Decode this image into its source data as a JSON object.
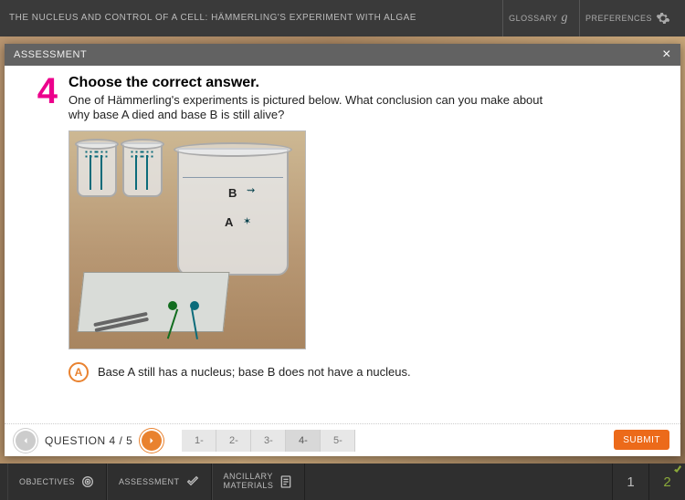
{
  "header": {
    "title": "THE NUCLEUS AND CONTROL OF A CELL: HÄMMERLING'S EXPERIMENT WITH ALGAE",
    "glossary_label": "GLOSSARY",
    "preferences_label": "PREFERENCES"
  },
  "panel": {
    "title": "ASSESSMENT"
  },
  "question": {
    "number": "4",
    "instruction": "Choose the correct answer.",
    "text": "One of Hämmerling's experiments is pictured below. What conclusion can you make about why base A died and base B is still alive?",
    "figure_labels": {
      "A": "A",
      "B": "B"
    },
    "answer_letter": "A",
    "answer_text": "Base A still has a nucleus; base B does not have a nucleus."
  },
  "footer": {
    "progress_label": "QUESTION 4 / 5",
    "tabs": [
      "1-",
      "2-",
      "3-",
      "4-",
      "5-"
    ],
    "submit_label": "SUBMIT"
  },
  "bottombar": {
    "objectives_label": "OBJECTIVES",
    "assessment_label": "ASSESSMENT",
    "ancillary_label_l1": "ANCILLARY",
    "ancillary_label_l2": "MATERIALS",
    "page_prev": "1",
    "page_curr": "2"
  }
}
